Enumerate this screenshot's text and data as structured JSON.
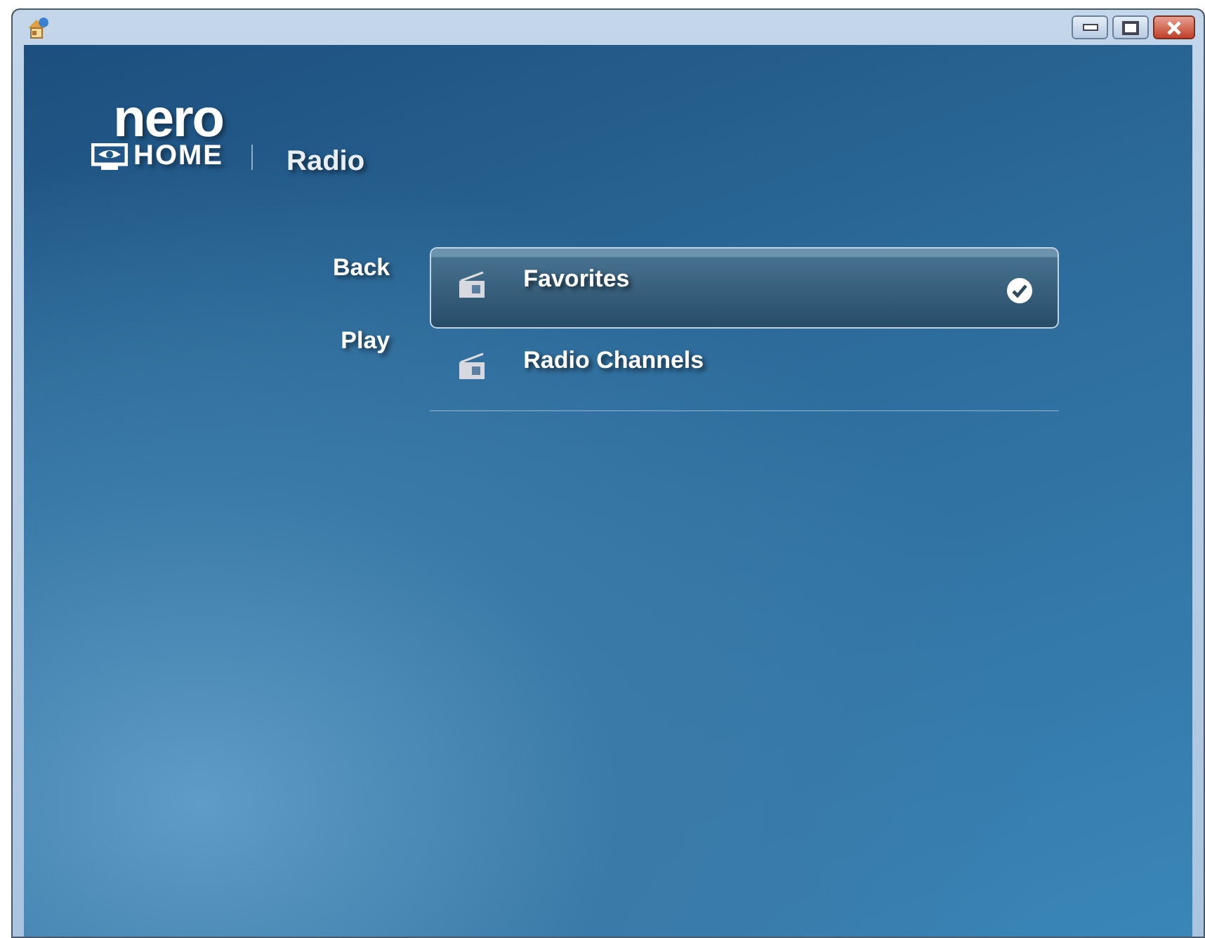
{
  "logo": {
    "brand": "nero",
    "product": "HOME"
  },
  "section_title": "Radio",
  "actions": [
    "Back",
    "Play"
  ],
  "menu_items": [
    {
      "label": "Favorites",
      "selected": true
    },
    {
      "label": "Radio Channels",
      "selected": false
    }
  ]
}
